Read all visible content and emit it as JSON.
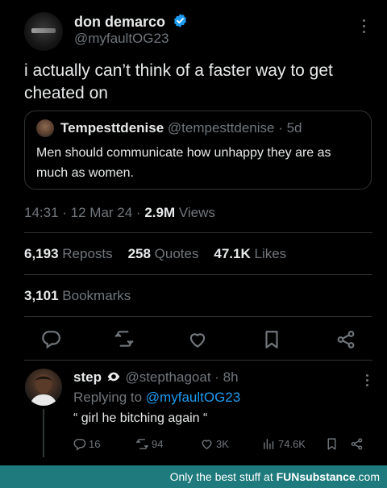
{
  "tweet": {
    "display_name": "don demarco",
    "handle": "@myfaultOG23",
    "text": "i actually can’t think of a faster way to get cheated on",
    "quote": {
      "name": "Tempesttdenise",
      "handle": "@tempesttdenise",
      "age": "· 5d",
      "text": "Men should communicate how unhappy they are as much as women."
    },
    "meta": {
      "time": "14:31",
      "date": "· 12 Mar 24 ·",
      "views_count": "2.9M",
      "views_label": "Views"
    },
    "stats": {
      "reposts_count": "6,193",
      "reposts_label": "Reposts",
      "quotes_count": "258",
      "quotes_label": "Quotes",
      "likes_count": "47.1K",
      "likes_label": "Likes",
      "bookmarks_count": "3,101",
      "bookmarks_label": "Bookmarks"
    },
    "actions": [
      "reply-icon",
      "repost-icon",
      "like-icon",
      "bookmark-icon",
      "share-icon"
    ]
  },
  "reply": {
    "name": "step",
    "handle": "@stepthagoat",
    "age": "· 8h",
    "replying_prefix": "Replying to",
    "replying_mention": "@myfaultOG23",
    "text": "“ girl he bitching again “",
    "replies": "16",
    "reposts": "94",
    "likes": "3K",
    "views": "74.6K"
  },
  "footer": {
    "prefix": "Only the best stuff at",
    "brand": "FUNsubstance",
    "suffix": ".com"
  },
  "colors": {
    "background": "#000000",
    "text": "#e7e9ea",
    "muted": "#71767b",
    "accent": "#1d9bf0",
    "footer_bg": "#1e7a7c"
  }
}
